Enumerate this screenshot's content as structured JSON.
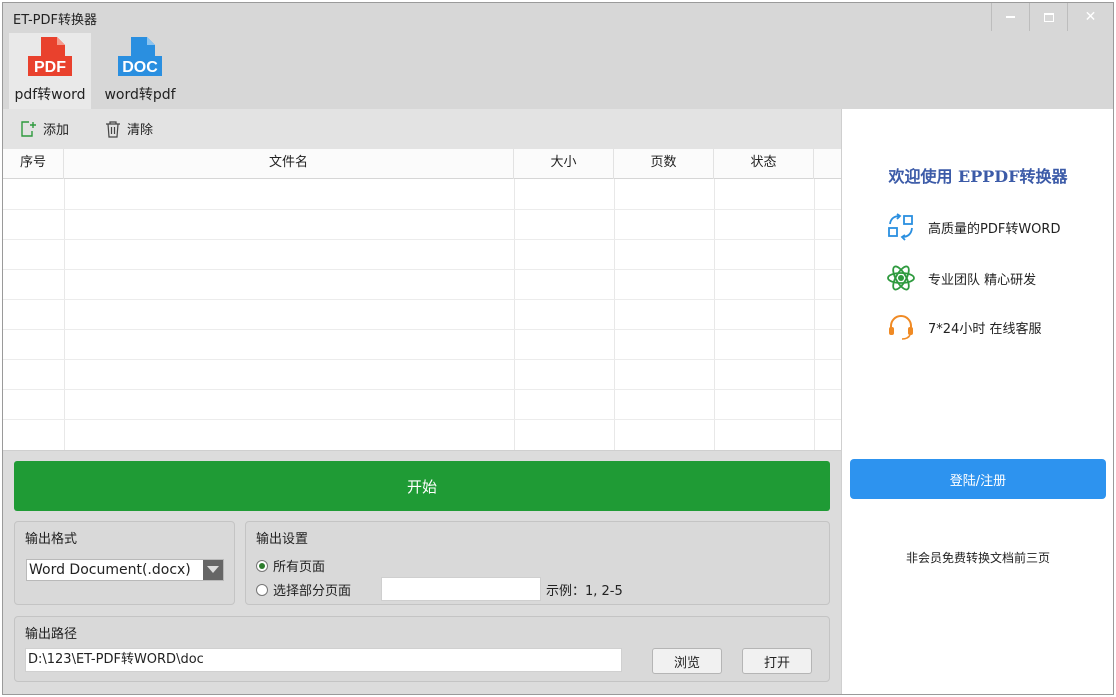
{
  "window": {
    "title": "ET-PDF转换器"
  },
  "toolbar": {
    "tools": [
      {
        "icon_text": "PDF",
        "label": "pdf转word",
        "color": "#e9412d"
      },
      {
        "icon_text": "DOC",
        "label": "word转pdf",
        "color": "#2a8fe0"
      }
    ]
  },
  "actions": {
    "add_label": "添加",
    "clear_label": "清除"
  },
  "table": {
    "columns": [
      "序号",
      "文件名",
      "大小",
      "页数",
      "状态"
    ],
    "rows": []
  },
  "start_button": {
    "label": "开始",
    "color": "#1f9b35"
  },
  "output_format": {
    "title": "输出格式",
    "selected": "Word Document(.docx)"
  },
  "output_settings": {
    "title": "输出设置",
    "option_all": "所有页面",
    "option_partial": "选择部分页面",
    "selected": "所有页面",
    "pages_value": "",
    "example": "示例：1, 2-5"
  },
  "output_path": {
    "title": "输出路径",
    "value": "D:\\123\\ET-PDF转WORD\\doc",
    "browse_label": "浏览",
    "open_label": "打开"
  },
  "promo": {
    "welcome": "欢迎使用 EPPDF转换器",
    "features": [
      {
        "icon": "convert-icon",
        "text": "高质量的PDF转WORD"
      },
      {
        "icon": "atom-icon",
        "text": "专业团队 精心研发"
      },
      {
        "icon": "headset-icon",
        "text": "7*24小时 在线客服"
      }
    ],
    "login_label": "登陆/注册",
    "login_color": "#2d93ef",
    "note": "非会员免费转换文档前三页"
  }
}
